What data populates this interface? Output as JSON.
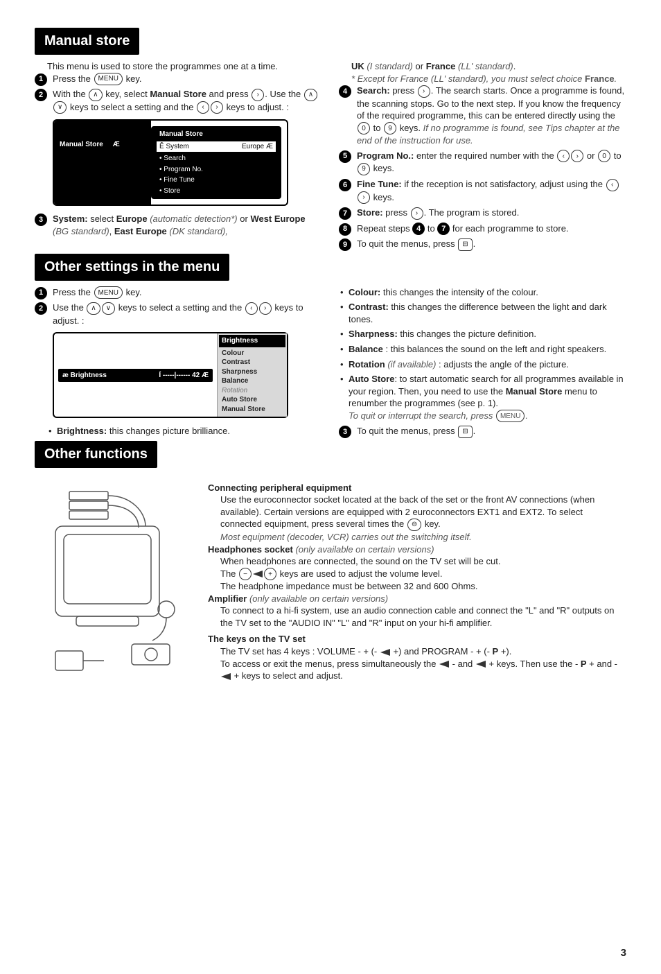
{
  "sections": {
    "manual_store": {
      "title": "Manual store",
      "intro": "This menu is used to store the programmes one at a time.",
      "steps": {
        "1": {
          "pre": "Press the ",
          "key": "MENU",
          "post": " key."
        },
        "2": {
          "a": "With the ",
          "key1": "∧",
          "b": " key, select ",
          "bold1": "Manual Store",
          "c": " and press ",
          "key2": "›",
          "d": ". Use the ",
          "key3": "∧",
          "key4": "∨",
          "e": " keys to select a setting and the ",
          "key5": "‹",
          "key6": "›",
          "f": " keys to adjust. :"
        },
        "3": {
          "a": "System:",
          "b": " select ",
          "bold1": "Europe",
          "c": " ",
          "ital1": "(automatic detection*)",
          "d": " or ",
          "bold2": "West Europe",
          "e": " ",
          "ital2": "(BG standard)",
          "f": ", ",
          "bold3": "East Europe",
          "g": " ",
          "ital3": "(DK standard),",
          "h": " ",
          "bold4": "UK",
          "i": " ",
          "ital4": "(I standard)",
          "j": " or ",
          "bold5": "France",
          "k": " ",
          "ital5": "(LL' standard)",
          "l": ".",
          "note1": "* Except for France (LL' standard), you must select choice ",
          "notebold": "France",
          "note2": "."
        },
        "4": {
          "a": "Search:",
          "b": " press ",
          "key1": "›",
          "c": ". The search starts. Once a programme is found, the scanning stops. Go to the next step. If you know the frequency of the required programme, this can be entered directly using the ",
          "key2": "0",
          "d": " to ",
          "key3": "9",
          "e": " keys. ",
          "ital": "If no programme is found, see Tips chapter at the end of the instruction for use."
        },
        "5": {
          "a": "Program No.:",
          "b": " enter the required number with the ",
          "key1": "‹",
          "key2": "›",
          "c": " or ",
          "key3": "0",
          "d": " to ",
          "key4": "9",
          "e": " keys."
        },
        "6": {
          "a": "Fine Tune:",
          "b": " if the reception is not satisfactory, adjust using the ",
          "key1": "‹",
          "key2": "›",
          "c": " keys."
        },
        "7": {
          "a": "Store:",
          "b": " press ",
          "key1": "›",
          "c": ". The program is stored."
        },
        "8": {
          "a": "Repeat steps ",
          "n1": "4",
          "b": " to ",
          "n2": "7",
          "c": " for each programme to store."
        },
        "9": {
          "a": "To quit the menus, press ",
          "key1": "⊟",
          "b": "."
        }
      },
      "ui": {
        "left": "Manual Store",
        "header": "Manual Store",
        "sel_label": "Ê System",
        "sel_value": "Europe Æ",
        "rows": [
          "• Search",
          "• Program No.",
          "• Fine Tune",
          "• Store"
        ]
      }
    },
    "other_settings": {
      "title": "Other settings in the menu",
      "steps": {
        "1": {
          "pre": "Press the ",
          "key": "MENU",
          "post": " key."
        },
        "2": {
          "a": "Use the ",
          "key1": "∧",
          "key2": "∨",
          "b": " keys to select a setting and the ",
          "key3": "‹",
          "key4": "›",
          "c": " keys to adjust. :"
        },
        "3": {
          "a": "To quit the menus, press ",
          "key1": "⊟",
          "b": "."
        }
      },
      "ui": {
        "slider_label": "æ Brightness",
        "slider_marks": "Í -----|------ 42 Æ",
        "items": [
          "Brightness",
          "Colour",
          "Contrast",
          "Sharpness",
          "Balance",
          "Rotation",
          "Auto Store",
          "Manual Store"
        ]
      },
      "bullets": {
        "brightness": {
          "label": "Brightness:",
          "text": " this changes picture brilliance."
        },
        "colour": {
          "label": "Colour:",
          "text": " this changes the intensity of the colour."
        },
        "contrast": {
          "label": "Contrast:",
          "text": " this changes the difference between the light and dark tones."
        },
        "sharpness": {
          "label": "Sharpness:",
          "text": " this changes the picture definition."
        },
        "balance": {
          "label": "Balance",
          "text": " : this balances the sound on the left and right speakers."
        },
        "rotation": {
          "label": "Rotation",
          "ital": " (if available) ",
          "text": ": adjusts the angle of the picture."
        },
        "autostore": {
          "label": "Auto Store",
          "text1": ": to start automatic search for all programmes available in your region. Then, you need to use the ",
          "bold": "Manual Store",
          "text2": " menu to renumber the programmes (see p. 1).",
          "ital": "To quit or interrupt the search, press ",
          "key": "MENU",
          "dot": "."
        }
      }
    },
    "other_functions": {
      "title": "Other functions",
      "connecting": {
        "head": "Connecting peripheral equipment",
        "p1a": "Use the euroconnector socket located at the back of the set or the front AV connections (when available). Certain versions are equipped with 2 euroconnectors EXT1 and EXT2. To select connected equipment, press several times the ",
        "key": "⊖",
        "p1b": " key.",
        "note": "Most equipment (decoder, VCR) carries out the switching itself."
      },
      "headphones": {
        "head": "Headphones socket",
        "ital": " (only available on certain versions)",
        "p1": "When headphones are connected, the sound on the TV set will be cut.",
        "p2a": "The ",
        "key1": "−",
        "key2": "+",
        "p2b": " keys are used to adjust the volume level.",
        "p3": "The headphone impedance must be between 32 and 600 Ohms."
      },
      "amp": {
        "head": "Amplifier",
        "ital": " (only available on certain versions)",
        "p1": "To connect to a hi-fi system, use an audio connection cable and connect the \"L\" and \"R\" outputs on the TV set to the \"AUDIO IN\" \"L\" and \"R\" input on your hi-fi amplifier."
      },
      "keys": {
        "head": "The keys on the TV set",
        "p1a": "The TV set has 4 keys : VOLUME - + (- ",
        "p1b": " +) and PROGRAM - + (- ",
        "bold1": "P",
        "p1c": " +).",
        "p2a": "To access or exit the menus, press simultaneously the ",
        "p2b": " - and ",
        "p2c": " + keys. Then use the - ",
        "bold2": "P",
        "p2d": " + and - ",
        "p2e": " + keys to select and adjust."
      }
    }
  },
  "page_number": "3"
}
